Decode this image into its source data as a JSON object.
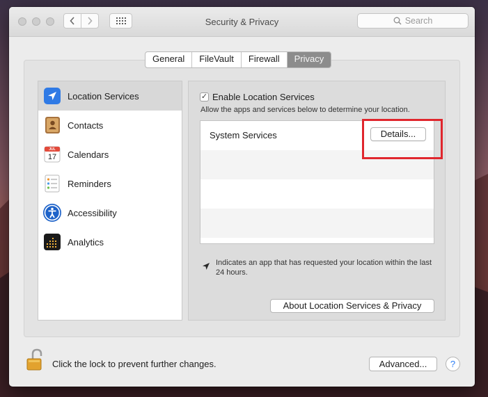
{
  "window": {
    "title": "Security & Privacy",
    "search_placeholder": "Search"
  },
  "tabs": [
    {
      "label": "General",
      "selected": false
    },
    {
      "label": "FileVault",
      "selected": false
    },
    {
      "label": "Firewall",
      "selected": false
    },
    {
      "label": "Privacy",
      "selected": true
    }
  ],
  "sidebar": {
    "items": [
      {
        "label": "Location Services",
        "icon": "location-services-icon",
        "selected": true
      },
      {
        "label": "Contacts",
        "icon": "contacts-icon",
        "selected": false
      },
      {
        "label": "Calendars",
        "icon": "calendar-icon",
        "selected": false
      },
      {
        "label": "Reminders",
        "icon": "reminders-icon",
        "selected": false
      },
      {
        "label": "Accessibility",
        "icon": "accessibility-icon",
        "selected": false
      },
      {
        "label": "Analytics",
        "icon": "analytics-icon",
        "selected": false
      }
    ]
  },
  "location": {
    "enable_label": "Enable Location Services",
    "enabled": true,
    "description": "Allow the apps and services below to determine your location.",
    "system_services_label": "System Services",
    "details_button": "Details...",
    "note": "Indicates an app that has requested your location within the last 24 hours.",
    "about_button": "About Location Services & Privacy"
  },
  "calendar_icon": {
    "month": "JUL",
    "day": "17"
  },
  "footer": {
    "lock_text": "Click the lock to prevent further changes.",
    "advanced_button": "Advanced...",
    "help_button": "?"
  },
  "colors": {
    "highlight": "#e0262d",
    "accent_blue": "#2b7df5"
  }
}
